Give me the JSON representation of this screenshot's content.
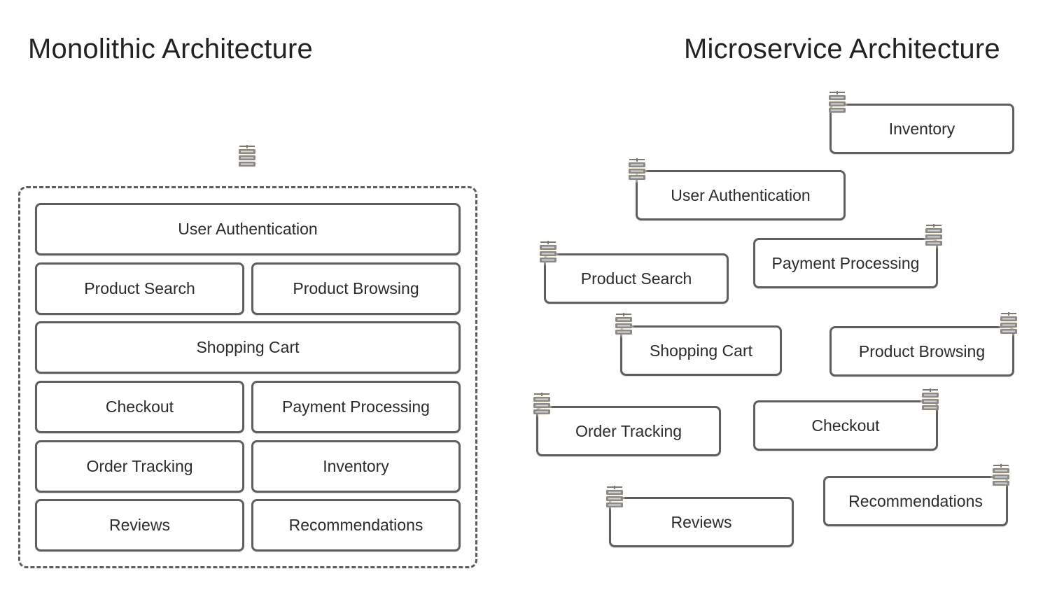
{
  "monolithic": {
    "title": "Monolithic Architecture",
    "modules": [
      "User Authentication",
      "Product Search",
      "Product Browsing",
      "Shopping Cart",
      "Checkout",
      "Payment Processing",
      "Order Tracking",
      "Inventory",
      "Reviews",
      "Recommendations"
    ],
    "server_icon": "server-icon"
  },
  "microservice": {
    "title": "Microservice Architecture",
    "services": [
      "Inventory",
      "User Authentication",
      "Payment Processing",
      "Product Search",
      "Shopping Cart",
      "Product Browsing",
      "Order Tracking",
      "Checkout",
      "Recommendations",
      "Reviews"
    ],
    "server_icon": "server-icon"
  },
  "colors": {
    "border": "#5f5f5f",
    "text": "#2b2b2b",
    "server_glow": "#fae8be",
    "server_body": "#8a8a8a"
  }
}
